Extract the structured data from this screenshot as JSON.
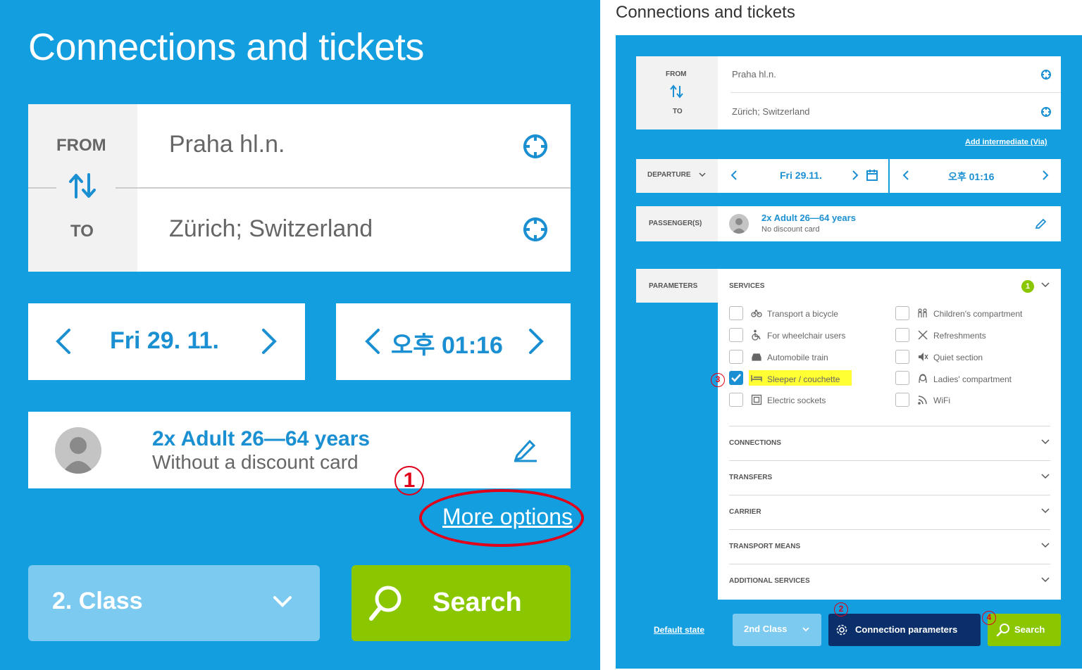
{
  "left": {
    "title": "Connections and tickets",
    "from_label": "FROM",
    "to_label": "TO",
    "from_value": "Praha hl.n.",
    "to_value": "Zürich; Switzerland",
    "date": "Fri 29. 11.",
    "time": "오후 01:16",
    "passenger_main": "2x Adult 26—64 years",
    "passenger_sub": "Without a discount card",
    "more_options": "More options",
    "annotation_1": "1",
    "class_select": "2. Class",
    "search_button": "Search"
  },
  "right": {
    "title": "Connections and tickets",
    "from_label": "FROM",
    "to_label": "TO",
    "from_value": "Praha hl.n.",
    "to_value": "Zürich; Switzerland",
    "add_intermediate": "Add intermediate (Via)",
    "departure_label": "DEPARTURE",
    "date": "Fri 29.11.",
    "time": "오후 01:16",
    "passengers_label": "PASSENGER(S)",
    "passenger_main": "2x Adult 26—64 years",
    "passenger_sub": "No discount card",
    "parameters_label": "PARAMETERS",
    "services_label": "SERVICES",
    "services_count": "1",
    "services_left": [
      {
        "label": "Transport a bicycle",
        "icon": "bicycle-icon",
        "checked": false
      },
      {
        "label": "For wheelchair users",
        "icon": "wheelchair-icon",
        "checked": false
      },
      {
        "label": "Automobile train",
        "icon": "car-icon",
        "checked": false
      },
      {
        "label": "Sleeper / couchette",
        "icon": "bed-icon",
        "checked": true
      },
      {
        "label": "Electric sockets",
        "icon": "socket-icon",
        "checked": false
      }
    ],
    "services_right": [
      {
        "label": "Children's compartment",
        "icon": "children-icon",
        "checked": false
      },
      {
        "label": "Refreshments",
        "icon": "cutlery-icon",
        "checked": false
      },
      {
        "label": "Quiet section",
        "icon": "mute-icon",
        "checked": false
      },
      {
        "label": "Ladies' compartment",
        "icon": "ladies-icon",
        "checked": false
      },
      {
        "label": "WiFi",
        "icon": "wifi-icon",
        "checked": false
      }
    ],
    "sections": [
      "CONNECTIONS",
      "TRANSFERS",
      "CARRIER",
      "TRANSPORT MEANS",
      "ADDITIONAL SERVICES"
    ],
    "default_state": "Default state",
    "class_select": "2nd Class",
    "connection_parameters": "Connection parameters",
    "search_button": "Search",
    "annotation_2": "2",
    "annotation_3": "3",
    "annotation_4": "4"
  },
  "colors": {
    "brand_blue": "#139ee0",
    "search_green": "#8bc700",
    "dark_navy": "#0a2f6b",
    "annotation_red": "#e0001a",
    "highlight_yellow": "#ffff33"
  }
}
